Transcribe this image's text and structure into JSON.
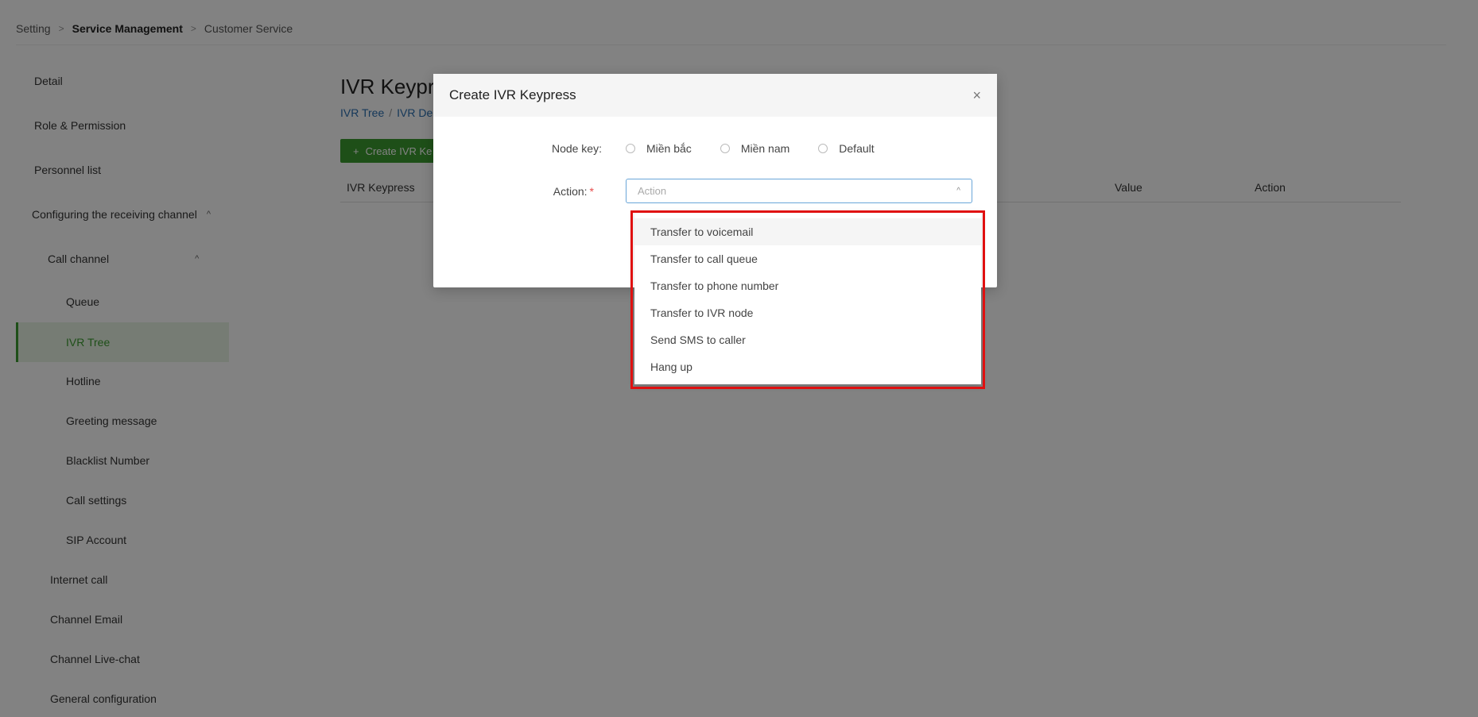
{
  "breadcrumb": {
    "items": [
      "Setting",
      "Service Management",
      "Customer Service"
    ]
  },
  "sidebar": {
    "items": [
      {
        "label": "Detail"
      },
      {
        "label": "Role & Permission"
      },
      {
        "label": "Personnel list"
      },
      {
        "label": "Configuring the receiving channel",
        "caret": "^"
      },
      {
        "label": "Call channel",
        "caret": "^"
      },
      {
        "label": "Queue"
      },
      {
        "label": "IVR Tree",
        "active": true
      },
      {
        "label": "Hotline"
      },
      {
        "label": "Greeting message"
      },
      {
        "label": "Blacklist Number"
      },
      {
        "label": "Call settings"
      },
      {
        "label": "SIP Account"
      },
      {
        "label": "Internet call"
      },
      {
        "label": "Channel Email"
      },
      {
        "label": "Channel Live-chat"
      },
      {
        "label": "General configuration"
      }
    ]
  },
  "main": {
    "title": "IVR Keypr",
    "sub_breadcrumb": [
      "IVR Tree",
      "IVR De"
    ],
    "create_button": {
      "icon": "+",
      "label": "Create IVR Ke"
    },
    "table_headers": [
      "IVR Keypress",
      "Value",
      "Action"
    ]
  },
  "modal": {
    "title": "Create IVR Keypress",
    "close_icon": "×",
    "node_key": {
      "label": "Node key:",
      "options": [
        "Miền bắc",
        "Miền nam",
        "Default"
      ]
    },
    "action": {
      "label": "Action:",
      "required_mark": "*",
      "placeholder": "Action",
      "chevron": "^",
      "options": [
        "Transfer to voicemail",
        "Transfer to call queue",
        "Transfer to phone number",
        "Transfer to IVR node",
        "Send SMS to caller",
        "Hang up"
      ]
    }
  },
  "colors": {
    "accent": "#3c9b2f",
    "highlight": "#e01010",
    "link": "#2a6fb0"
  }
}
